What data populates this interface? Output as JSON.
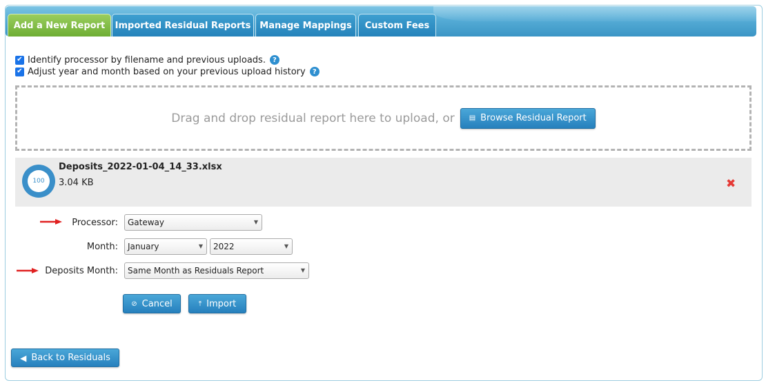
{
  "tabs": [
    {
      "label": "Add a New Report"
    },
    {
      "label": "Imported Residual Reports"
    },
    {
      "label": "Manage Mappings"
    },
    {
      "label": "Custom Fees"
    }
  ],
  "options": {
    "identify_label": "Identify processor by filename and previous uploads.",
    "adjust_label": "Adjust year and month based on your previous upload history"
  },
  "dropzone": {
    "text": "Drag and drop residual report here to upload, or",
    "browse_label": "Browse Residual Report"
  },
  "file": {
    "name": "Deposits_2022-01-04_14_33.xlsx",
    "size": "3.04 KB",
    "progress": 100,
    "progress_label": "100"
  },
  "form": {
    "processor_label": "Processor:",
    "processor_value": "Gateway",
    "month_label": "Month:",
    "month_value": "January",
    "year_value": "2022",
    "deposits_month_label": "Deposits Month:",
    "deposits_month_value": "Same Month as Residuals Report"
  },
  "actions": {
    "cancel_label": "Cancel",
    "import_label": "Import",
    "back_label": "Back to Residuals"
  },
  "colors": {
    "active_tab": "#7cbf45",
    "tab": "#2e8ac4",
    "button": "#2f8cc9",
    "remove": "#e53935",
    "annotation_arrow": "#e02020"
  }
}
